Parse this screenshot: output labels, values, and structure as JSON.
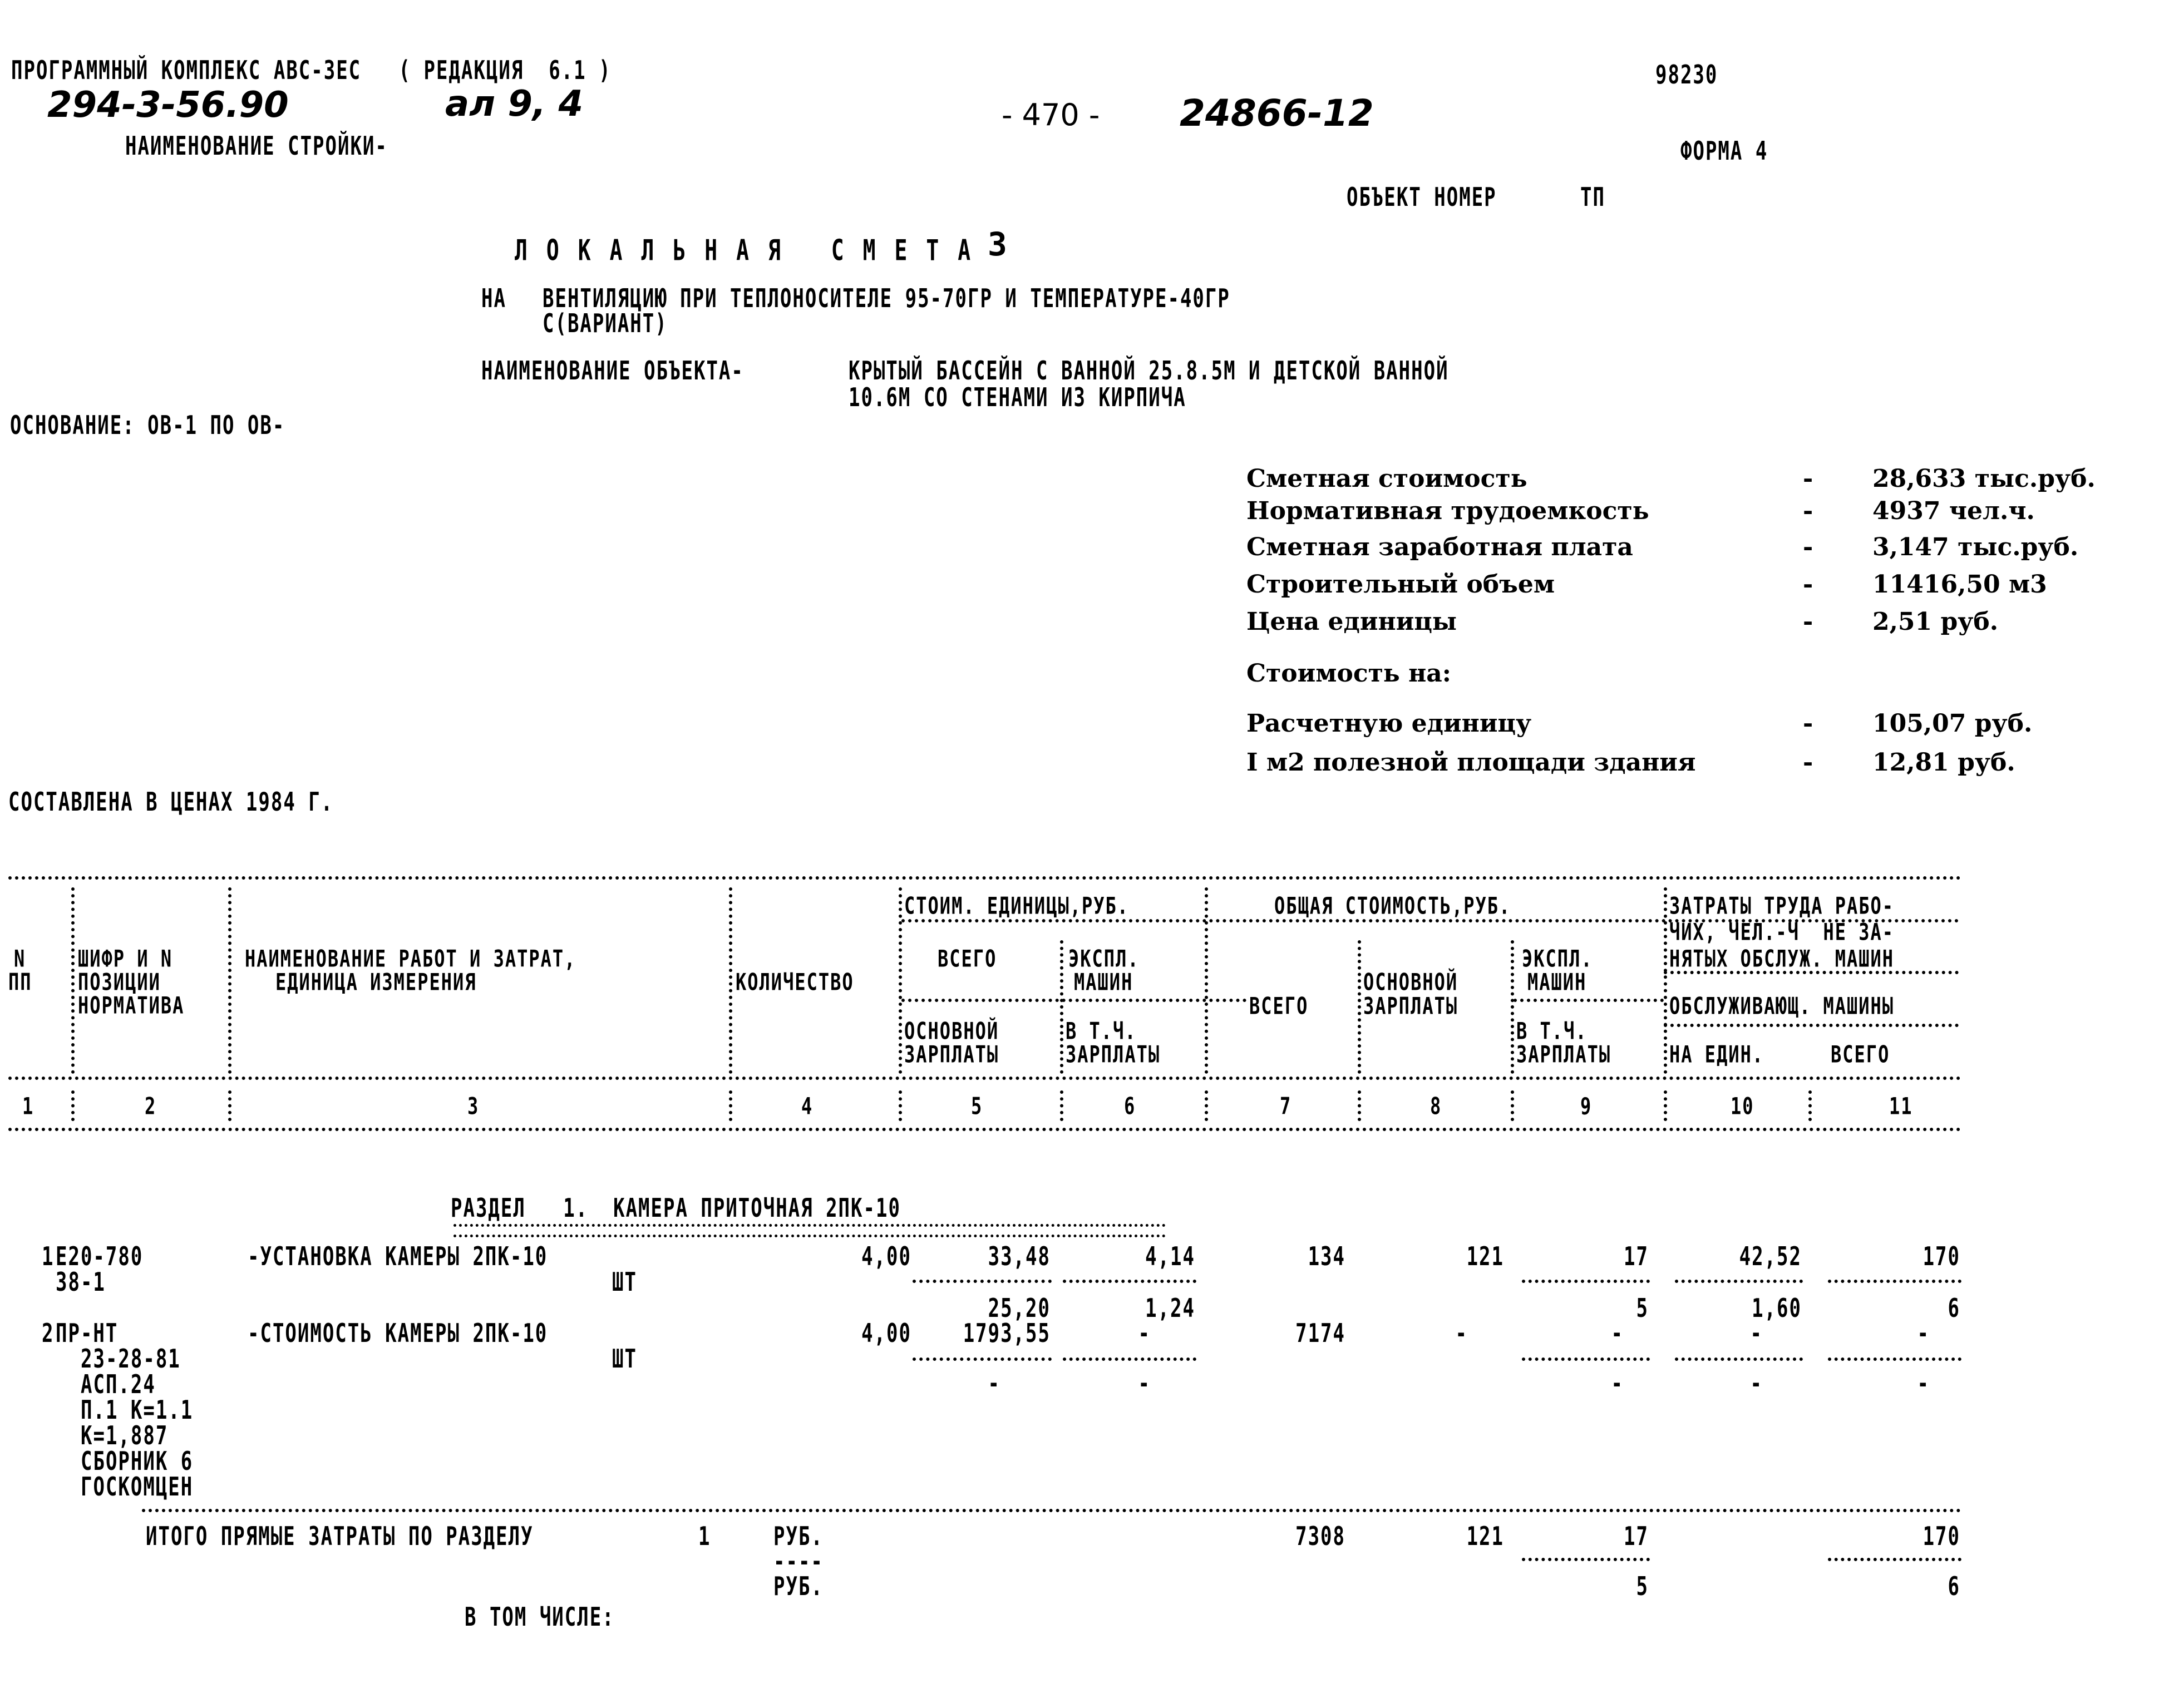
{
  "header": {
    "program": "ПРОГРАММНЫЙ КОМПЛЕКС АВС-3ЕС   ( РЕДАКЦИЯ  6.1 )",
    "handwritten_code": "294-3-56.90",
    "handwritten_album": "ал 9, 4",
    "page_number": "- 470 -",
    "handwritten_doc_number": "24866-12",
    "doc_code": "98230",
    "construction_label": "НАИМЕНОВАНИЕ СТРОЙКИ-",
    "form_label": "ФОРМА 4",
    "object_number_label": "ОБЪЕКТ НОМЕР",
    "object_number_value": "ТП"
  },
  "title": {
    "text": "ЛОКАЛЬНАЯ СМЕТА",
    "number": "3",
    "subject_prefix": "НА",
    "subject_line1": "ВЕНТИЛЯЦИЮ ПРИ ТЕПЛОНОСИТЕЛЕ 95-70ГР И ТЕМПЕРАТУРЕ-40ГР",
    "subject_line2": "С(ВАРИАНТ)",
    "object_label": "НАИМЕНОВАНИЕ ОБЪЕКТА-",
    "object_line1": "КРЫТЫЙ БАССЕЙН С ВАННОЙ 25.8.5М И ДЕТСКОЙ ВАННОЙ",
    "object_line2": "10.6М СО СТЕНАМИ ИЗ КИРПИЧА"
  },
  "basis": "ОСНОВАНИЕ: ОВ-1 ПО ОВ-",
  "prices_note": "СОСТАВЛЕНА В ЦЕНАХ 1984 Г.",
  "summary": {
    "rows": [
      {
        "label": "Сметная стоимость",
        "dash": "-",
        "value": "28,633 тыс.руб."
      },
      {
        "label": "Нормативная трудоемкость",
        "dash": "-",
        "value": "4937 чел.ч."
      },
      {
        "label": "Сметная заработная плата",
        "dash": "-",
        "value": "3,147 тыс.руб."
      },
      {
        "label": "Строительный объем",
        "dash": "-",
        "value": "11416,50 м3"
      },
      {
        "label": "Цена единицы",
        "dash": "-",
        "value": "2,51 руб."
      }
    ],
    "cost_per_label": "Стоимость на:",
    "cost_per_rows": [
      {
        "label": "Расчетную единицу",
        "dash": "-",
        "value": "105,07 руб."
      },
      {
        "label": "I м2 полезной площади здания",
        "dash": "-",
        "value": "12,81 руб."
      }
    ]
  },
  "table": {
    "headers": {
      "col1": [
        "N",
        "ПП"
      ],
      "col2": [
        "ШИФР И N",
        "ПОЗИЦИИ",
        "НОРМАТИВА"
      ],
      "col3": [
        "НАИМЕНОВАНИЕ РАБОТ И ЗАТРАТ,",
        "ЕДИНИЦА ИЗМЕРЕНИЯ"
      ],
      "col4": "КОЛИЧЕСТВО",
      "unit_cost_group": "СТОИМ. ЕДИНИЦЫ,РУБ.",
      "col5_top": "ВСЕГО",
      "col5_bottom": [
        "ОСНОВНОЙ",
        "ЗАРПЛАТЫ"
      ],
      "col6_top": [
        "ЭКСПЛ.",
        "МАШИН"
      ],
      "col6_bottom": [
        "В Т.Ч.",
        "ЗАРПЛАТЫ"
      ],
      "total_cost_group": "ОБЩАЯ СТОИМОСТЬ,РУБ.",
      "col7": "ВСЕГО",
      "col8": [
        "ОСНОВНОЙ",
        "ЗАРПЛАТЫ"
      ],
      "col9_top": [
        "ЭКСПЛ.",
        "МАШИН"
      ],
      "col9_bottom": [
        "В Т.Ч.",
        "ЗАРПЛАТЫ"
      ],
      "labor_group": [
        "ЗАТРАТЫ ТРУДА РАБО-",
        "ЧИХ, ЧЕЛ.-Ч  НЕ ЗА-",
        "НЯТЫХ ОБСЛУЖ. МАШИН"
      ],
      "labor_sub": "ОБСЛУЖИВАЮЩ. МАШИНЫ",
      "col10": "НА ЕДИН.",
      "col11": "ВСЕГО"
    },
    "column_numbers": [
      "1",
      "2",
      "3",
      "4",
      "5",
      "6",
      "7",
      "8",
      "9",
      "10",
      "11"
    ],
    "section": {
      "title": "РАЗДЕЛ   1.  КАМЕРА ПРИТОЧНАЯ 2ПК-10",
      "rows": [
        {
          "n": "1",
          "code": [
            "Е20-780",
            "38-1"
          ],
          "name": "-УСТАНОВКА КАМЕРЫ 2ПК-10",
          "unit": "ШТ",
          "qty": "4,00",
          "unit_total": "33,48",
          "unit_machines": "4,14",
          "unit_wage": "25,20",
          "unit_machine_wage": "1,24",
          "total": "134",
          "total_wage": "121",
          "total_machines": "17",
          "total_machine_wage": "5",
          "labor_per_unit": "42,52",
          "labor_per_unit_sub": "1,60",
          "labor_total": "170",
          "labor_total_sub": "6"
        },
        {
          "n": "2",
          "code": [
            "ПР-НТ",
            "23-28-81",
            "АСП.24",
            "П.1 К=1.1",
            "К=1,887",
            "СБОРНИК 6",
            "ГОСКОМЦЕН"
          ],
          "name": "-СТОИМОСТЬ КАМЕРЫ 2ПК-10",
          "unit": "ШТ",
          "qty": "4,00",
          "unit_total": "1793,55",
          "unit_machines": "-",
          "unit_wage": "-",
          "unit_machine_wage": "-",
          "total": "7174",
          "total_wage": "-",
          "total_machines": "-",
          "total_machine_wage": "-",
          "labor_per_unit": "-",
          "labor_per_unit_sub": "-",
          "labor_total": "-",
          "labor_total_sub": "-"
        }
      ],
      "total": {
        "label": "ИТОГО ПРЯМЫЕ ЗАТРАТЫ ПО РАЗДЕЛУ",
        "section_no": "1",
        "unit1": "РУБ.",
        "unit_dash": "----",
        "unit2": "РУБ.",
        "total": "7308",
        "total_wage": "121",
        "total_machines": "17",
        "total_machine_wage": "5",
        "labor_total": "170",
        "labor_total_sub": "6"
      },
      "including_label": "В ТОМ ЧИСЛЕ:"
    }
  }
}
